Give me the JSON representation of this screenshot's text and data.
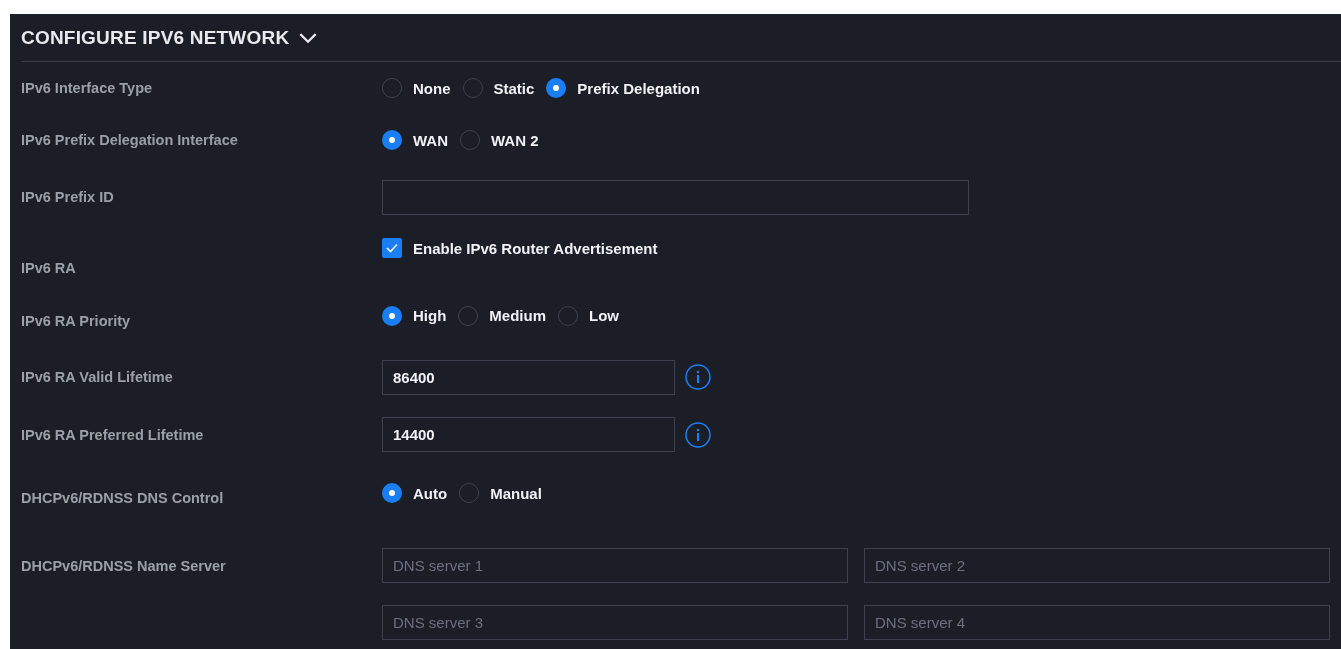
{
  "section": {
    "title": "CONFIGURE IPV6 NETWORK",
    "expanded": true
  },
  "rows": [
    {
      "kind": "radio",
      "label": "IPv6 Interface Type",
      "options": [
        {
          "label": "None",
          "selected": false
        },
        {
          "label": "Static",
          "selected": false
        },
        {
          "label": "Prefix Delegation",
          "selected": true
        }
      ]
    },
    {
      "kind": "radio",
      "label": "IPv6 Prefix Delegation Interface",
      "options": [
        {
          "label": "WAN",
          "selected": true
        },
        {
          "label": "WAN 2",
          "selected": false
        }
      ]
    },
    {
      "kind": "field",
      "label": "IPv6 Prefix ID"
    },
    {
      "kind": "checkbox",
      "label": "IPv6 RA",
      "option": {
        "label": "Enable IPv6 Router Advertisement",
        "checked": true
      }
    },
    {
      "kind": "radio",
      "label": "IPv6 RA Priority",
      "options": [
        {
          "label": "High",
          "selected": true
        },
        {
          "label": "Medium",
          "selected": false
        },
        {
          "label": "Low",
          "selected": false
        }
      ]
    },
    {
      "kind": "field-info",
      "label": "IPv6 RA Valid Lifetime",
      "value": "86400"
    },
    {
      "kind": "field-info",
      "label": "IPv6 RA Preferred Lifetime",
      "value": "14400"
    },
    {
      "kind": "radio",
      "label": "DHCPv6/RDNSS DNS Control",
      "options": [
        {
          "label": "Auto",
          "selected": true
        },
        {
          "label": "Manual",
          "selected": false
        }
      ]
    },
    {
      "kind": "fields",
      "label": "DHCPv6/RDNSS Name Server",
      "fields": [
        {
          "placeholder": "DNS server 1"
        },
        {
          "placeholder": "DNS server 2"
        },
        {
          "placeholder": "DNS server 3"
        },
        {
          "placeholder": "DNS server 4"
        }
      ]
    }
  ]
}
